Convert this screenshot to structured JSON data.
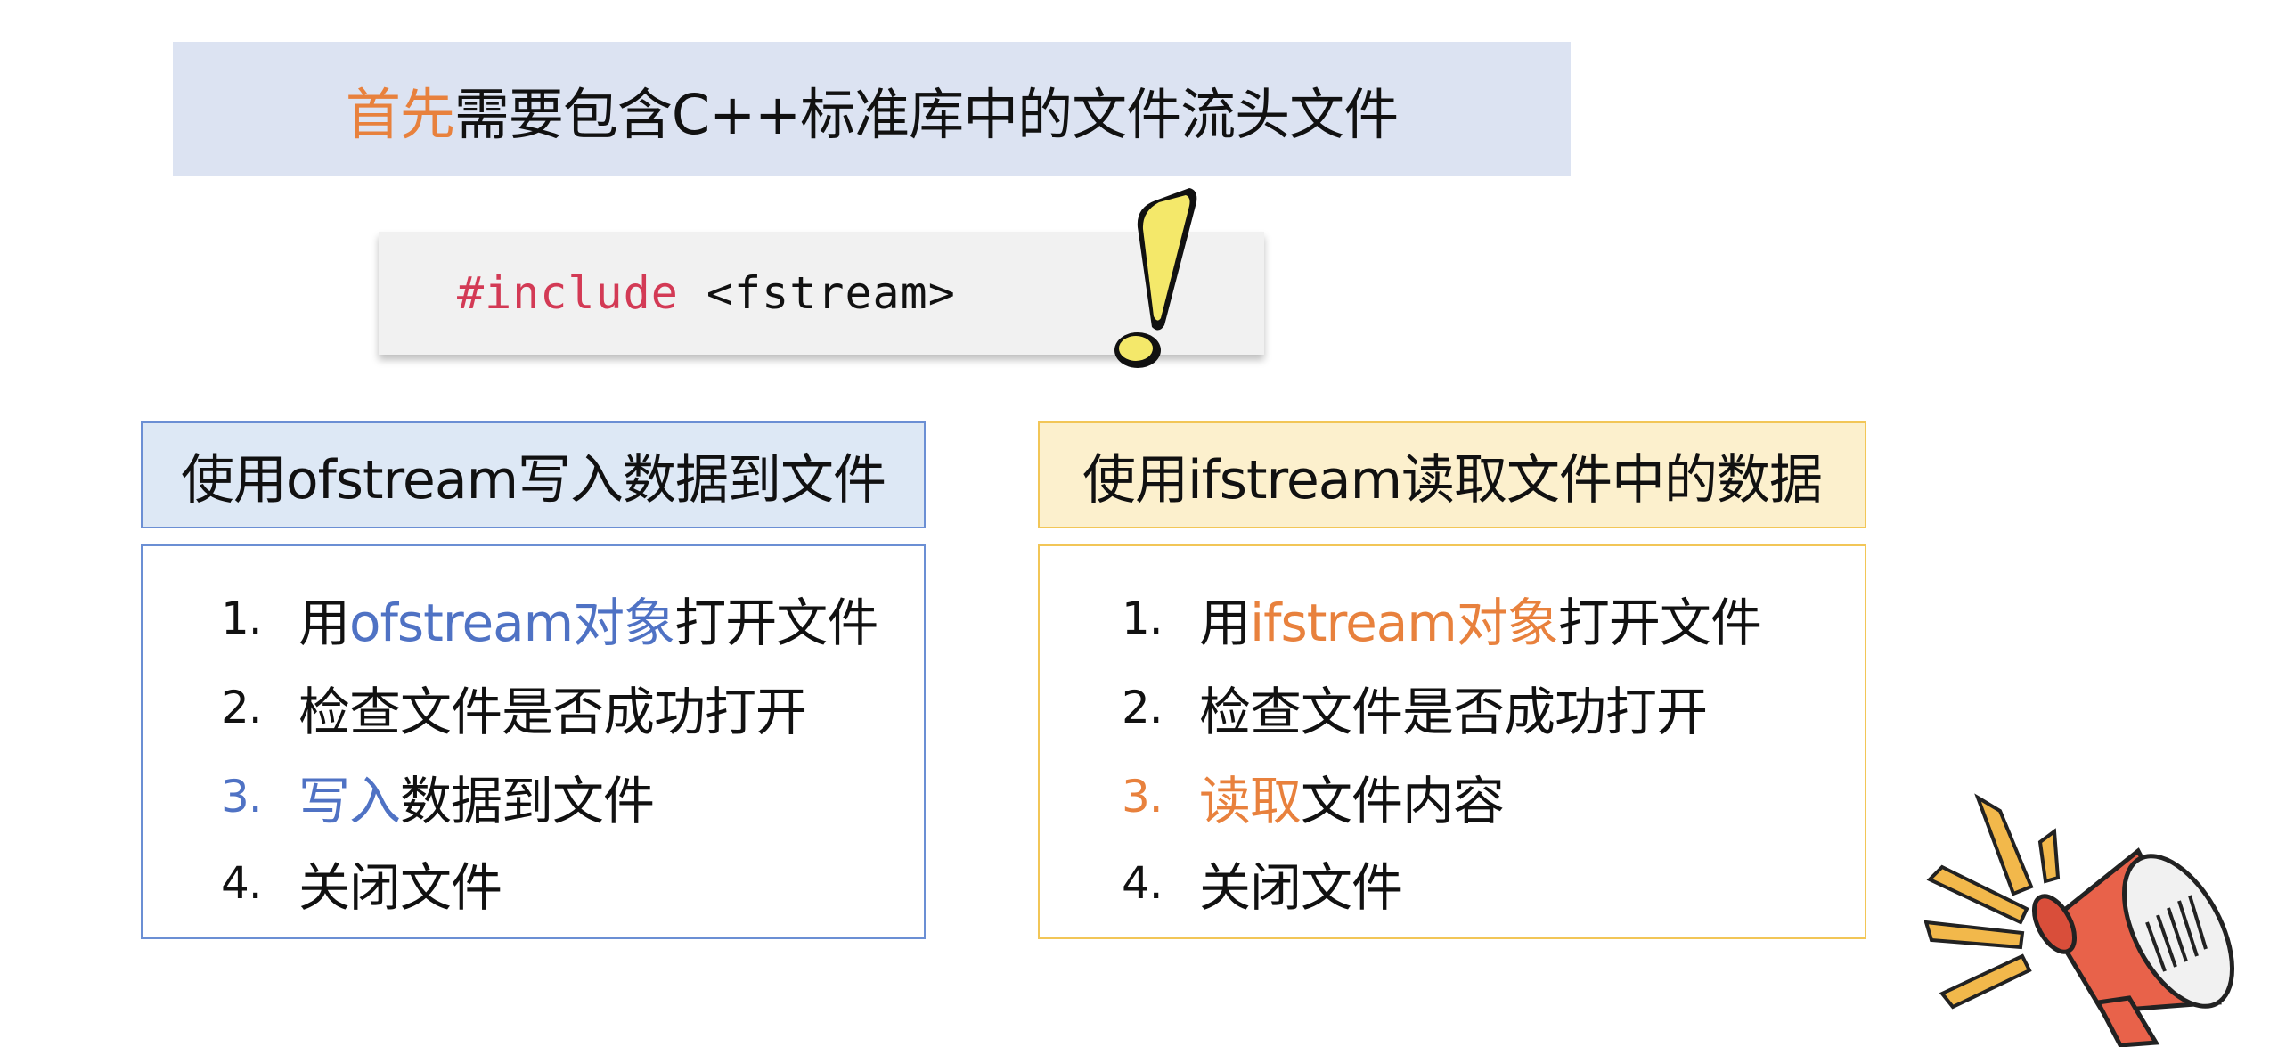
{
  "banner": {
    "highlight": "首先",
    "rest": "需要包含C++标准库中的文件流头文件"
  },
  "code": {
    "keyword": "#include",
    "header": " <fstream>"
  },
  "colors": {
    "orange": "#e8813d",
    "blue": "#4f72c4",
    "code_keyword": "#d33a55",
    "banner_bg": "#dce3f2",
    "left_header_bg": "#dde8f5",
    "right_header_bg": "#fcf0cd"
  },
  "left": {
    "title": "使用ofstream写入数据到文件",
    "steps": [
      {
        "num": "1.",
        "pre": "用",
        "highlight": "ofstream对象",
        "post": "打开文件"
      },
      {
        "num": "2.",
        "text": "检查文件是否成功打开"
      },
      {
        "num": "3.",
        "highlight": "写入",
        "post": "数据到文件"
      },
      {
        "num": "4.",
        "text": "关闭文件"
      }
    ]
  },
  "right": {
    "title": "使用ifstream读取文件中的数据",
    "steps": [
      {
        "num": "1.",
        "pre": "用",
        "highlight": "ifstream对象",
        "post": "打开文件"
      },
      {
        "num": "2.",
        "text": "检查文件是否成功打开"
      },
      {
        "num": "3.",
        "highlight": "读取",
        "post": "文件内容"
      },
      {
        "num": "4.",
        "text": "关闭文件"
      }
    ]
  },
  "icons": {
    "exclamation": "exclamation-icon",
    "megaphone": "megaphone-icon"
  }
}
